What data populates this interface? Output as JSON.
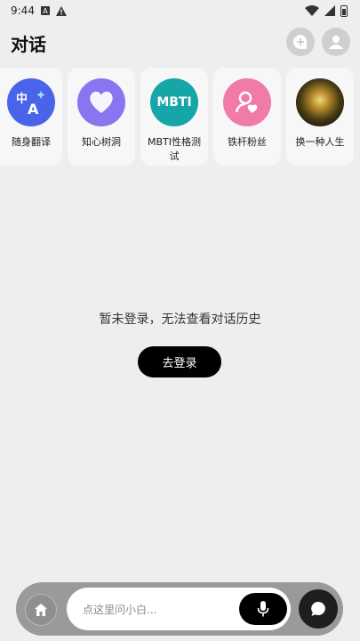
{
  "status_bar": {
    "time": "9:44",
    "a_badge": "A"
  },
  "header": {
    "title": "对话"
  },
  "agents": [
    {
      "name": "随身翻译",
      "icon": "translate-icon",
      "glyph": "中A"
    },
    {
      "name": "知心树洞",
      "icon": "heart-icon"
    },
    {
      "name": "MBTI性格测试",
      "icon": "mbti-icon",
      "glyph": "MBTI"
    },
    {
      "name": "铁杆粉丝",
      "icon": "fan-icon"
    },
    {
      "name": "换一种人生",
      "icon": "life-avatar-icon"
    }
  ],
  "empty_state": {
    "message": "暂未登录，无法查看对话历史",
    "login_label": "去登录"
  },
  "bottom_bar": {
    "placeholder": "点这里问小白..."
  }
}
